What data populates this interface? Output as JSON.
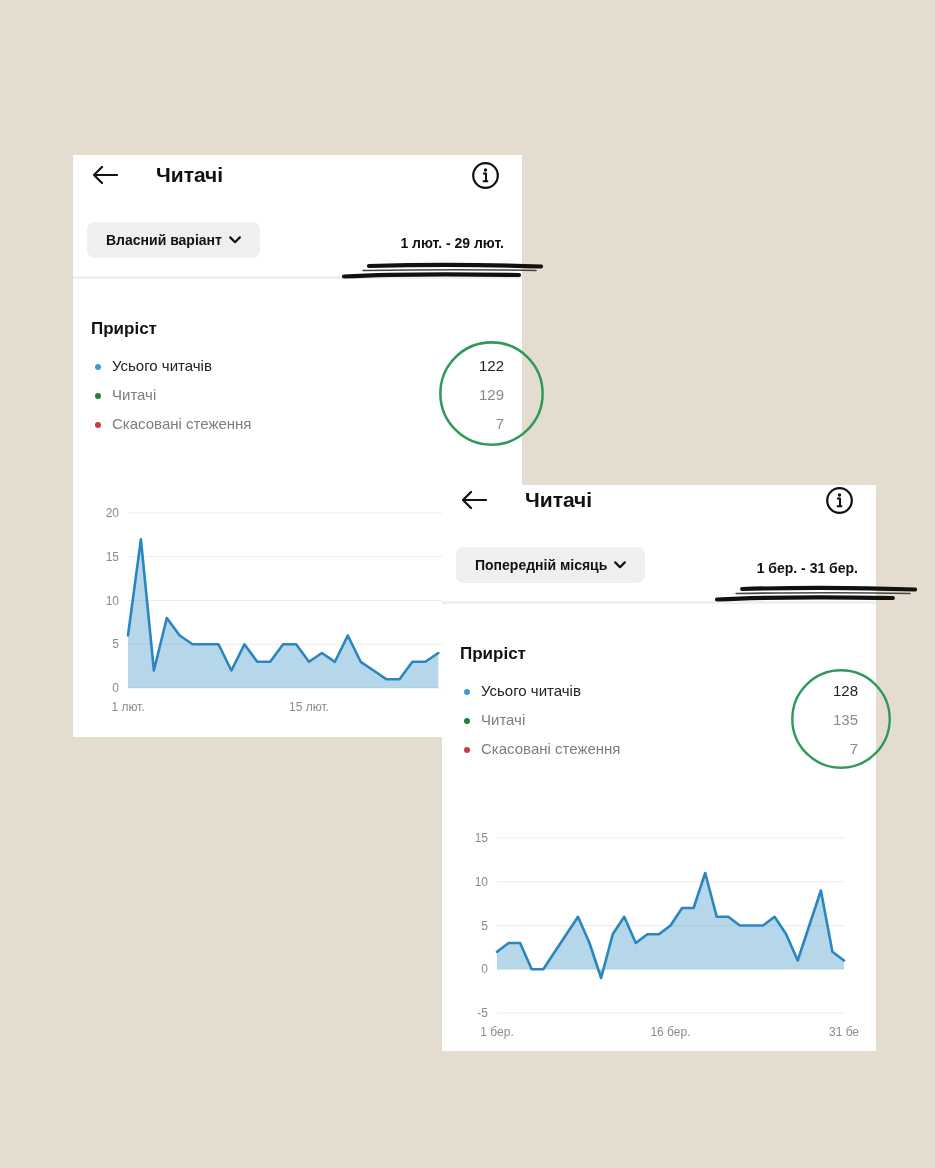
{
  "screens": [
    {
      "header": {
        "title": "Читачі"
      },
      "period_dropdown": {
        "label": "Власний варіант"
      },
      "date_range": "1 лют. - 29 лют.",
      "growth": {
        "title": "Приріст",
        "rows": [
          {
            "kind": "total",
            "color": "#3d9ad6",
            "label": "Усього читачів",
            "value": "122"
          },
          {
            "kind": "part",
            "color": "#2b7a3f",
            "label": "Читачі",
            "value": "129"
          },
          {
            "kind": "part",
            "color": "#c73a4a",
            "label": "Скасовані стеження",
            "value": "7"
          }
        ]
      },
      "chart_data": {
        "type": "area",
        "grid": true,
        "x": [
          1,
          2,
          3,
          4,
          5,
          6,
          7,
          8,
          9,
          10,
          11,
          12,
          13,
          14,
          15,
          16,
          17,
          18,
          19,
          20,
          21,
          22,
          23,
          24,
          25
        ],
        "series": [
          {
            "color": "#2a86bf",
            "values": [
              6,
              17,
              2,
              8,
              6,
              5,
              5,
              5,
              2,
              5,
              3,
              3,
              5,
              5,
              3,
              4,
              3,
              6,
              3,
              2,
              1,
              1,
              3,
              3,
              4
            ]
          }
        ],
        "xlim": [
          1,
          29
        ],
        "ylim": [
          0,
          20
        ],
        "xticks": [
          {
            "value": 1,
            "label": "1 лют."
          },
          {
            "value": 15,
            "label": "15 лют."
          }
        ],
        "yticks": [
          0,
          5,
          10,
          15,
          20
        ]
      }
    },
    {
      "header": {
        "title": "Читачі"
      },
      "period_dropdown": {
        "label": "Попередній місяць"
      },
      "date_range": "1 бер. - 31 бер.",
      "growth": {
        "title": "Приріст",
        "rows": [
          {
            "kind": "total",
            "color": "#3d9ad6",
            "label": "Усього читачів",
            "value": "128"
          },
          {
            "kind": "part",
            "color": "#2b7a3f",
            "label": "Читачі",
            "value": "135"
          },
          {
            "kind": "part",
            "color": "#c73a4a",
            "label": "Скасовані стеження",
            "value": "7"
          }
        ]
      },
      "chart_data": {
        "type": "area",
        "grid": true,
        "x": [
          1,
          2,
          3,
          4,
          5,
          6,
          7,
          8,
          9,
          10,
          11,
          12,
          13,
          14,
          15,
          16,
          17,
          18,
          19,
          20,
          21,
          22,
          23,
          24,
          25,
          26,
          27,
          28,
          29,
          30,
          31
        ],
        "series": [
          {
            "color": "#2a86bf",
            "values": [
              2,
              3,
              3,
              0,
              0,
              2,
              4,
              6,
              3,
              -1,
              4,
              6,
              3,
              4,
              4,
              5,
              7,
              7,
              11,
              6,
              6,
              5,
              5,
              5,
              6,
              4,
              1,
              5,
              9,
              2,
              1
            ]
          }
        ],
        "xlim": [
          1,
          31
        ],
        "ylim": [
          -5,
          15
        ],
        "xticks": [
          {
            "value": 1,
            "label": "1 бер."
          },
          {
            "value": 16,
            "label": "16 бер."
          },
          {
            "value": 31,
            "label": "31 бе"
          }
        ],
        "yticks": [
          -5,
          0,
          5,
          10,
          15
        ]
      }
    }
  ]
}
